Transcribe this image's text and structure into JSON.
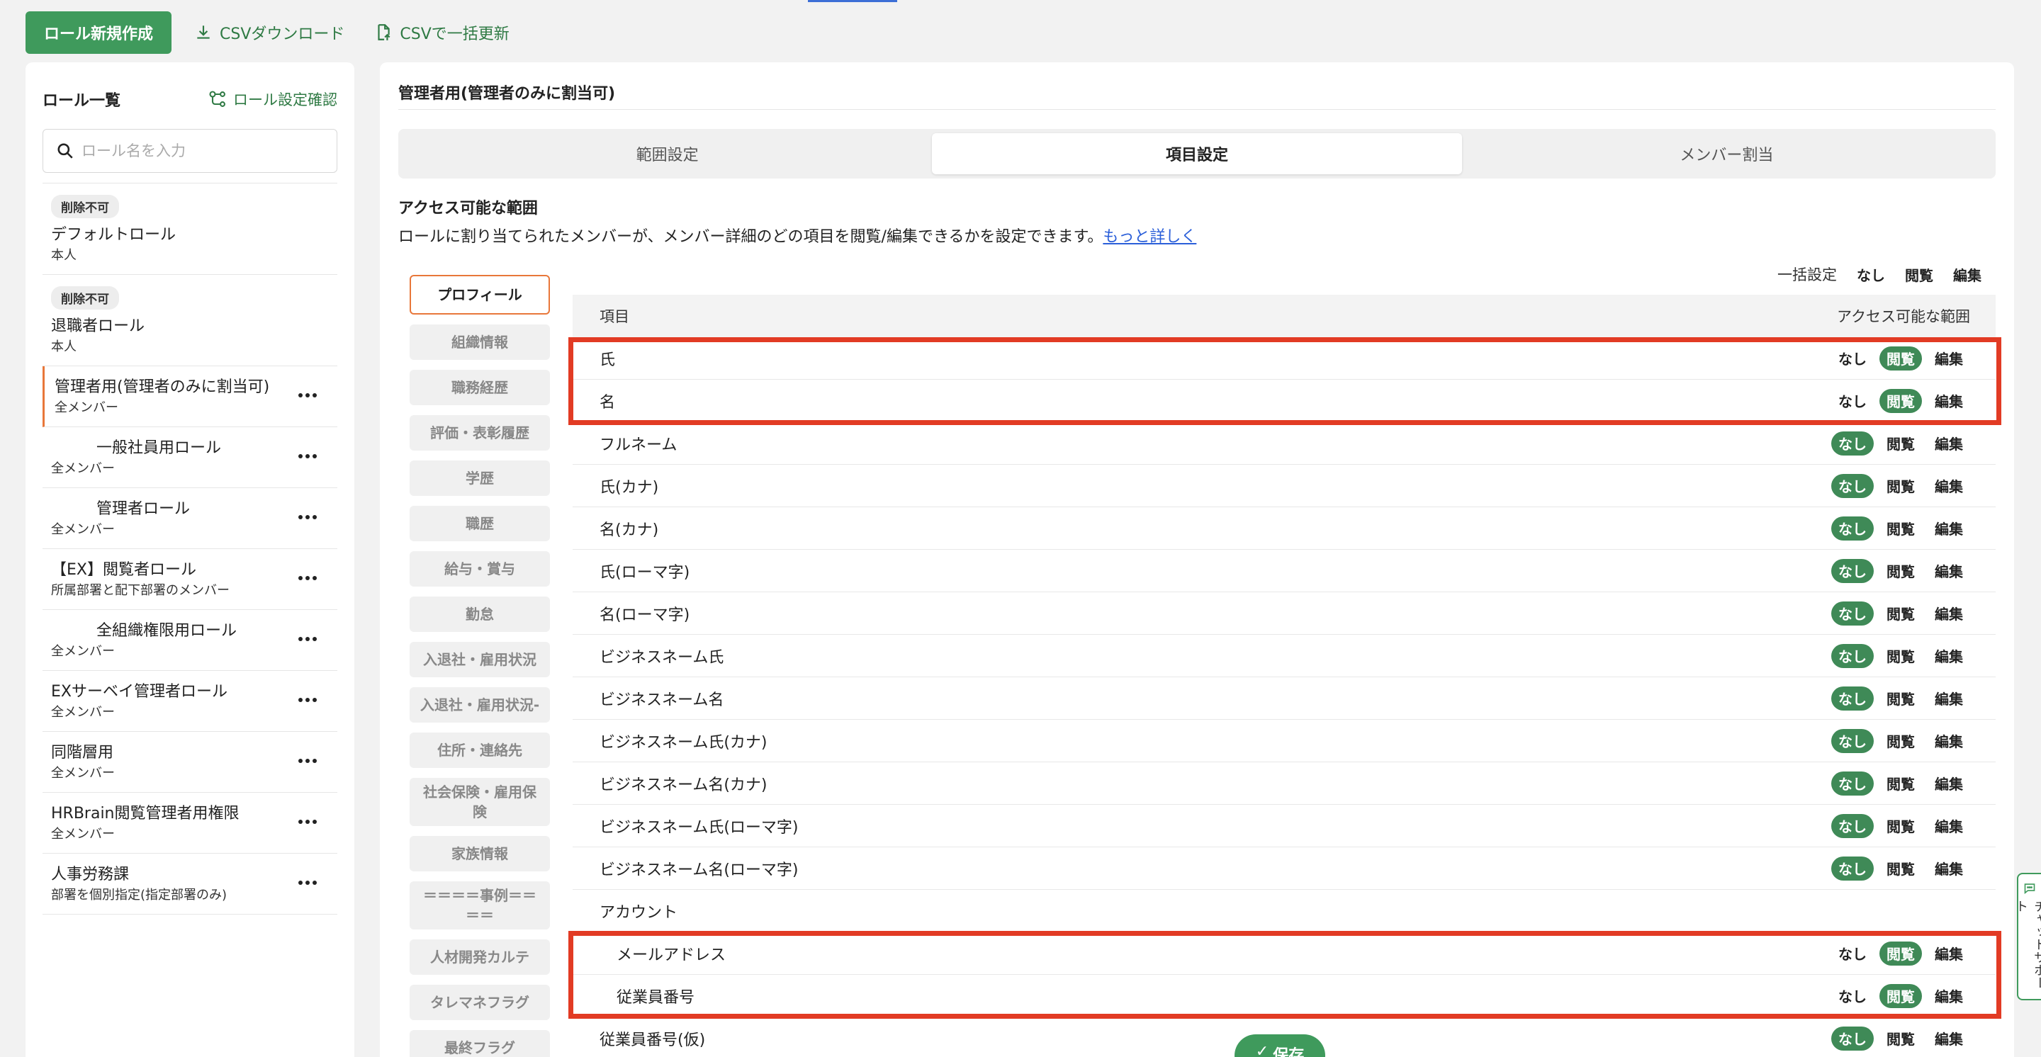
{
  "toolbar": {
    "create_label": "ロール新規作成",
    "csv_download_label": "CSVダウンロード",
    "csv_update_label": "CSVで一括更新"
  },
  "sidebar": {
    "title": "ロール一覧",
    "role_check_label": "ロール設定確認",
    "search_placeholder": "ロール名を入力",
    "roles": [
      {
        "badge": "削除不可",
        "name": "デフォルトロール",
        "sub": "本人"
      },
      {
        "badge": "削除不可",
        "name": "退職者ロール",
        "sub": "本人"
      },
      {
        "name": "管理者用(管理者のみに割当可)",
        "sub": "全メンバー"
      },
      {
        "name": "一般社員用ロール",
        "sub": "全メンバー"
      },
      {
        "name": "管理者ロール",
        "sub": "全メンバー"
      },
      {
        "name": "【EX】閲覧者ロール",
        "sub": "所属部署と配下部署のメンバー"
      },
      {
        "name": "全組織権限用ロール",
        "sub": "全メンバー"
      },
      {
        "name": "EXサーベイ管理者ロール",
        "sub": "全メンバー"
      },
      {
        "name": "同階層用",
        "sub": "全メンバー"
      },
      {
        "name": "HRBrain閲覧管理者用権限",
        "sub": "全メンバー"
      },
      {
        "name": "人事労務課",
        "sub": "部署を個別指定(指定部署のみ)"
      }
    ]
  },
  "main": {
    "title": "管理者用(管理者のみに割当可)",
    "tabs": [
      "範囲設定",
      "項目設定",
      "メンバー割当"
    ],
    "section_title": "アクセス可能な範囲",
    "section_desc": "ロールに割り当てられたメンバーが、メンバー詳細のどの項目を閲覧/編集できるかを設定できます。",
    "more_link": "もっと詳しく",
    "categories": [
      "プロフィール",
      "組織情報",
      "職務経歴",
      "評価・表彰履歴",
      "学歴",
      "職歴",
      "給与・賞与",
      "勤怠",
      "入退社・雇用状況",
      "入退社・雇用状況-",
      "住所・連絡先",
      "社会保険・雇用保険",
      "家族情報",
      "＝＝＝＝事例＝＝＝＝",
      "人材開発カルテ",
      "タレマネフラグ",
      "最終フラグ"
    ],
    "bulk_label": "一括設定",
    "options": [
      "なし",
      "閲覧",
      "編集"
    ],
    "table": {
      "header_item": "項目",
      "header_access": "アクセス可能な範囲",
      "rows": [
        {
          "label": "氏",
          "selected": "閲覧"
        },
        {
          "label": "名",
          "selected": "閲覧"
        },
        {
          "label": "フルネーム",
          "selected": "なし"
        },
        {
          "label": "氏(カナ)",
          "selected": "なし"
        },
        {
          "label": "名(カナ)",
          "selected": "なし"
        },
        {
          "label": "氏(ローマ字)",
          "selected": "なし"
        },
        {
          "label": "名(ローマ字)",
          "selected": "なし"
        },
        {
          "label": "ビジネスネーム氏",
          "selected": "なし"
        },
        {
          "label": "ビジネスネーム名",
          "selected": "なし"
        },
        {
          "label": "ビジネスネーム氏(カナ)",
          "selected": "なし"
        },
        {
          "label": "ビジネスネーム名(カナ)",
          "selected": "なし"
        },
        {
          "label": "ビジネスネーム氏(ローマ字)",
          "selected": "なし"
        },
        {
          "label": "ビジネスネーム名(ローマ字)",
          "selected": "なし"
        },
        {
          "label": "アカウント",
          "group": true
        },
        {
          "label": "メールアドレス",
          "selected": "閲覧",
          "sub": true
        },
        {
          "label": "従業員番号",
          "selected": "閲覧",
          "sub": true
        },
        {
          "label": "従業員番号(仮)",
          "selected": "なし"
        }
      ]
    },
    "save_label": "保存"
  },
  "chat_support_label": "チャットサポート",
  "colors": {
    "primary_green": "#3f9a5c",
    "selected_green": "#3f8a57",
    "accent_orange": "#e8773a",
    "highlight_red": "#e23b24"
  }
}
